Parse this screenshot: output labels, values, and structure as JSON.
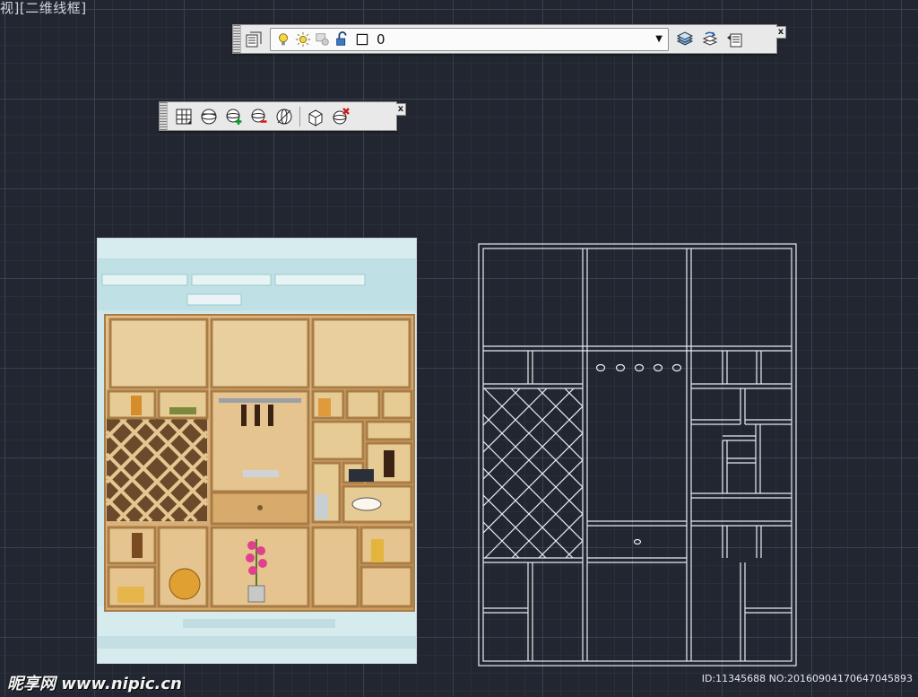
{
  "viewport": {
    "label": "视][二维线框]"
  },
  "layer_toolbar": {
    "current_layer": "0",
    "icons": [
      "layer-properties-icon",
      "lightbulb-on-icon",
      "sun-freeze-icon",
      "viewport-freeze-icon",
      "lock-open-icon",
      "color-swatch-icon",
      "layer-states-icon",
      "make-current-icon",
      "layer-previous-icon"
    ],
    "close_label": "x"
  },
  "view_toolbar": {
    "icons": [
      "wireframe-box-icon",
      "sphere-icon",
      "sphere-add-icon",
      "sphere-subtract-icon",
      "sphere-nosym-icon",
      "box-3d-icon",
      "sphere-delete-icon"
    ],
    "close_label": "x"
  },
  "reference_photo": {
    "subject": "wine-cabinet-photo"
  },
  "colors": {
    "background": "#212631",
    "grid": "#3c4452",
    "cad_lines": "#e8ecf0",
    "wood": "#d8b27e"
  },
  "watermark": {
    "site": "昵享网 www.nipic.cn",
    "id_text": "ID:11345688 NO:20160904170647045893"
  }
}
